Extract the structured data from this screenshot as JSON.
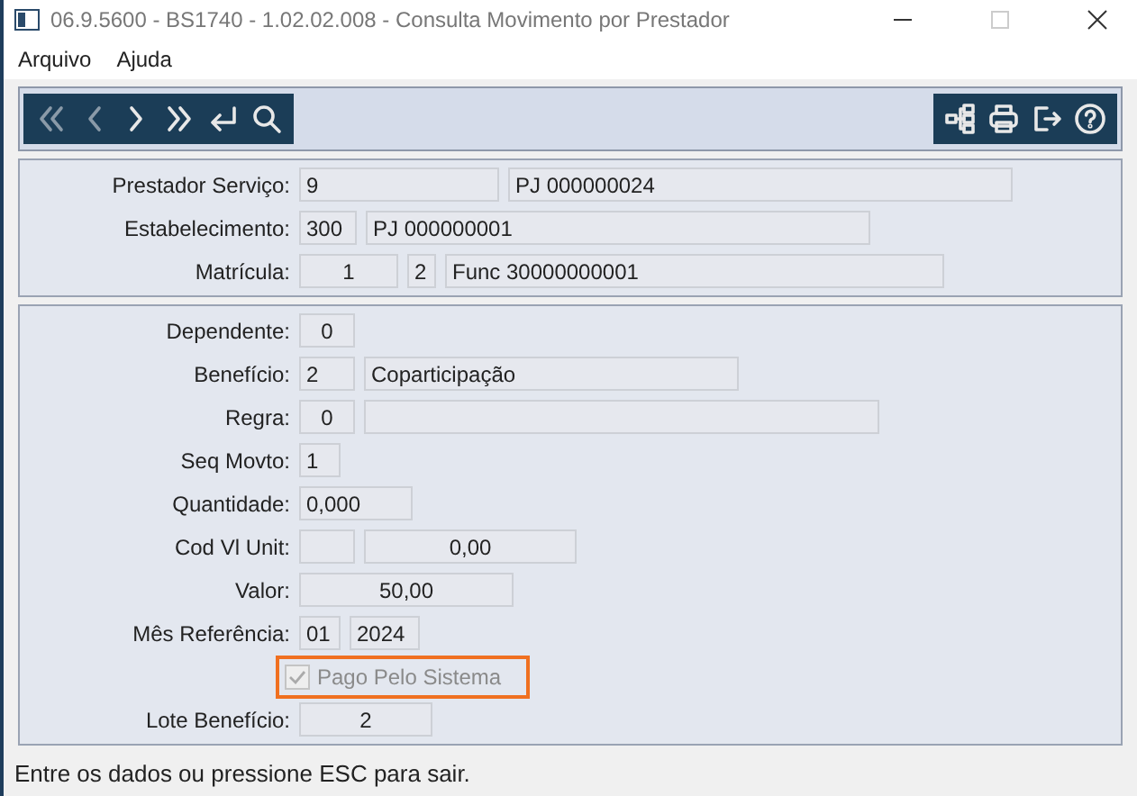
{
  "window": {
    "title": "06.9.5600 - BS1740 - 1.02.02.008 - Consulta Movimento por Prestador"
  },
  "menu": [
    {
      "label": "Arquivo"
    },
    {
      "label": "Ajuda"
    }
  ],
  "header_panel": [
    {
      "kind": "fields",
      "label": "Prestador Serviço:",
      "fields": [
        "9",
        "PJ 000000024"
      ]
    },
    {
      "kind": "fields",
      "label": "Estabelecimento:",
      "fields": [
        "300",
        "PJ 000000001"
      ]
    },
    {
      "kind": "fields",
      "label": "Matrícula:",
      "fields": [
        "1",
        "2",
        "Func 30000000001"
      ]
    }
  ],
  "detail_panel": [
    {
      "kind": "fields",
      "label": "Dependente:",
      "fields": [
        "0"
      ]
    },
    {
      "kind": "fields",
      "label": "Benefício:",
      "fields": [
        "2",
        "Coparticipação"
      ]
    },
    {
      "kind": "fields",
      "label": "Regra:",
      "fields": [
        "0",
        {
          "kind": "blank"
        }
      ]
    },
    {
      "kind": "fields",
      "label": "Seq Movto:",
      "fields": [
        "1"
      ]
    },
    {
      "kind": "fields",
      "label": "Quantidade:",
      "fields": [
        "0,000"
      ]
    },
    {
      "kind": "fields",
      "label": "Cod Vl Unit:",
      "fields": [
        {
          "kind": "blank"
        },
        "0,00"
      ]
    },
    {
      "kind": "fields",
      "label": "Valor:",
      "fields": [
        "50,00"
      ]
    },
    {
      "kind": "fields",
      "label": "Mês Referência:",
      "fields": [
        "01",
        "2024"
      ]
    },
    {
      "kind": "checkbox",
      "label": "Pago Pelo Sistema",
      "checked": true,
      "disabled": true,
      "highlighted": true
    },
    {
      "kind": "fields",
      "label": "Lote Benefício:",
      "fields": [
        "2"
      ]
    }
  ],
  "status_bar": "Entre os dados ou pressione ESC para sair."
}
